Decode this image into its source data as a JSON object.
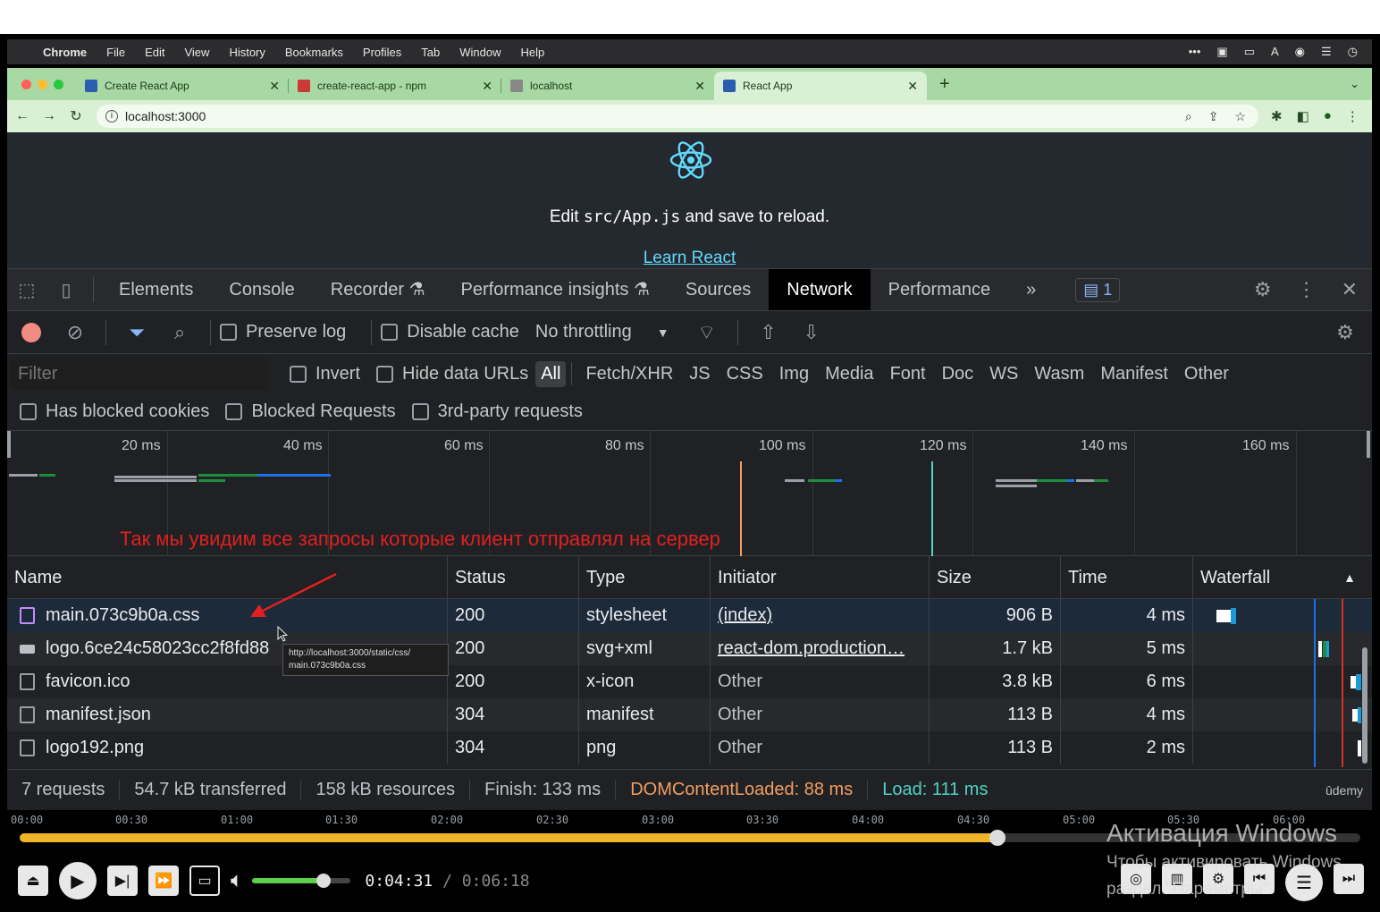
{
  "menubar": {
    "items": [
      "Chrome",
      "File",
      "Edit",
      "View",
      "History",
      "Bookmarks",
      "Profiles",
      "Tab",
      "Window",
      "Help"
    ]
  },
  "tabs": [
    {
      "title": "Create React App",
      "fav_color": "#2a5db0"
    },
    {
      "title": "create-react-app - npm",
      "fav_color": "#cb3837"
    },
    {
      "title": "localhost",
      "fav_color": "#888888"
    },
    {
      "title": "React App",
      "fav_color": "#2a5db0",
      "active": true
    }
  ],
  "address": {
    "url": "localhost:3000"
  },
  "page": {
    "edit_prefix": "Edit ",
    "edit_code": "src/App.js",
    "edit_suffix": " and save to reload.",
    "learn_link": "Learn React"
  },
  "devtools": {
    "tabs": [
      "Elements",
      "Console",
      "Recorder",
      "Performance insights",
      "Sources",
      "Network",
      "Performance"
    ],
    "active_tab": "Network",
    "issues_count": "1",
    "toolbar": {
      "preserve_log": "Preserve log",
      "disable_cache": "Disable cache",
      "throttling": "No throttling"
    },
    "filter": {
      "placeholder": "Filter",
      "invert": "Invert",
      "hide_data_urls": "Hide data URLs",
      "types": [
        "All",
        "Fetch/XHR",
        "JS",
        "CSS",
        "Img",
        "Media",
        "Font",
        "Doc",
        "WS",
        "Wasm",
        "Manifest",
        "Other"
      ],
      "active_type": "All"
    },
    "filter2": {
      "blocked_cookies": "Has blocked cookies",
      "blocked_requests": "Blocked Requests",
      "third_party": "3rd-party requests"
    },
    "overview_ticks": [
      "20 ms",
      "40 ms",
      "60 ms",
      "80 ms",
      "100 ms",
      "120 ms",
      "140 ms",
      "160 ms"
    ],
    "annotation": "Так мы увидим все запросы которые клиент отправлял на сервер",
    "columns": [
      "Name",
      "Status",
      "Type",
      "Initiator",
      "Size",
      "Time",
      "Waterfall"
    ],
    "rows": [
      {
        "name": "main.073c9b0a.css",
        "status": "200",
        "type": "stylesheet",
        "initiator": "(index)",
        "size": "906 B",
        "time": "4 ms"
      },
      {
        "name": "logo.6ce24c58023cc2f8fd88",
        "status": "200",
        "type": "svg+xml",
        "initiator": "react-dom.production…",
        "size": "1.7 kB",
        "time": "5 ms"
      },
      {
        "name": "favicon.ico",
        "status": "200",
        "type": "x-icon",
        "initiator": "Other",
        "size": "3.8 kB",
        "time": "6 ms"
      },
      {
        "name": "manifest.json",
        "status": "304",
        "type": "manifest",
        "initiator": "Other",
        "size": "113 B",
        "time": "4 ms"
      },
      {
        "name": "logo192.png",
        "status": "304",
        "type": "png",
        "initiator": "Other",
        "size": "113 B",
        "time": "2 ms"
      }
    ],
    "tooltip": {
      "line1": "http://localhost:3000/static/css/",
      "line2": "main.073c9b0a.css"
    },
    "summary": {
      "requests": "7 requests",
      "transferred": "54.7 kB transferred",
      "resources": "158 kB resources",
      "finish": "Finish: 133 ms",
      "dcl": "DOMContentLoaded: 88 ms",
      "load": "Load: 111 ms"
    },
    "watermark": "ûdemy"
  },
  "player": {
    "timeline_labels": [
      "00:00",
      "00:30",
      "01:00",
      "01:30",
      "02:00",
      "02:30",
      "03:00",
      "03:30",
      "04:00",
      "04:30",
      "05:00",
      "05:30",
      "06:00"
    ],
    "progress": 0.7294,
    "volume": 0.72,
    "current": "0:04:31",
    "separator": " / ",
    "total": "0:06:18"
  },
  "windows_activation": {
    "title": "Активация Windows",
    "line2": "Чтобы активировать Windows,",
    "line3": "раздел \"Параметры\"."
  }
}
